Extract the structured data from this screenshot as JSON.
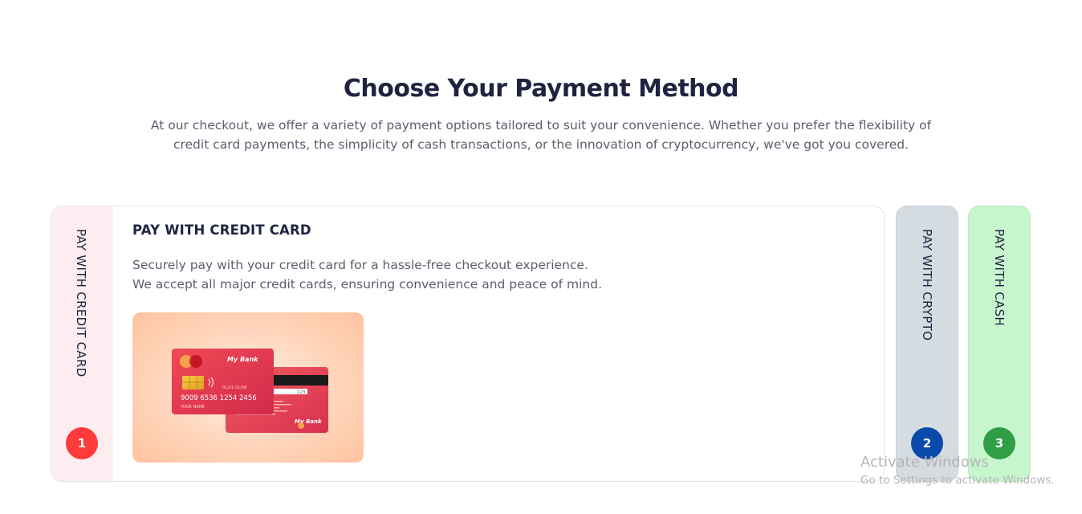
{
  "header": {
    "title": "Choose Your Payment Method",
    "intro_line1": "At our checkout, we offer a variety of payment options tailored to suit your convenience. Whether you prefer the flexibility of",
    "intro_line2": "credit card payments, the simplicity of cash transactions, or the innovation of cryptocurrency, we've got you covered."
  },
  "tabs": [
    {
      "label": "PAY WITH CREDIT CARD",
      "number": "1",
      "badge_color": "#ff3b3b",
      "rail_color": "#fdedf0",
      "active": true,
      "title": "PAY WITH CREDIT CARD",
      "desc_line1": "Securely pay with your credit card for a hassle-free checkout experience.",
      "desc_line2": "We accept all major credit cards, ensuring convenience and peace of mind.",
      "card": {
        "front_bank": "My Bank",
        "front_number": "9009  6536  1254  2456",
        "front_expiry": "01/21   01/08",
        "front_name": "YOUR NAME",
        "back_cvv": "123",
        "back_bank": "My Bank"
      }
    },
    {
      "label": "PAY WITH CRYPTO",
      "number": "2",
      "badge_color": "#0a4aab",
      "rail_color": "#d4dbe1",
      "active": false
    },
    {
      "label": "PAY WITH CASH",
      "number": "3",
      "badge_color": "#2f9e44",
      "rail_color": "#c7f5ce",
      "active": false
    }
  ],
  "os_watermark": {
    "title": "Activate Windows",
    "subtitle": "Go to Settings to activate Windows."
  }
}
